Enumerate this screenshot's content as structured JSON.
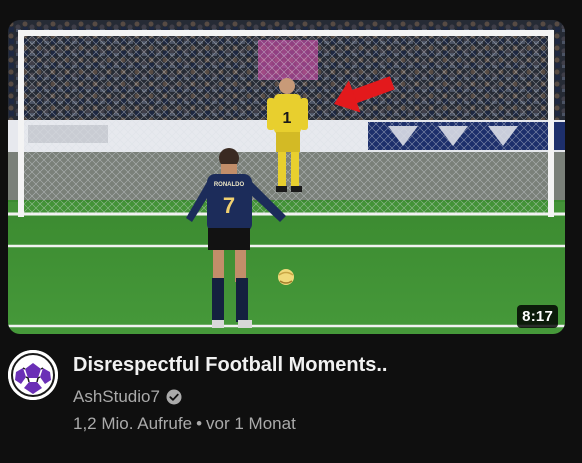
{
  "video": {
    "duration": "8:17",
    "title": "Disrespectful Football Moments..",
    "channel": "AshStudio7",
    "views": "1,2 Mio. Aufrufe",
    "separator": "•",
    "age": "vor 1 Monat",
    "jersey_front_name": "RONALDO",
    "striker_number": "7",
    "keeper_number": "1"
  },
  "icons": {
    "verified": "verified-check-icon",
    "avatar": "channel-avatar-ball-icon",
    "arrow": "red-arrow-icon"
  },
  "colors": {
    "background": "#0f0f0f",
    "title": "#f1f1f1",
    "secondary_text": "#aaaaaa",
    "pitch": "#3f8f33",
    "keeper_kit": "#e8cf2e",
    "striker_kit": "#1c2c5a",
    "arrow": "#e3191c",
    "avatar_purple": "#6a2fb6"
  }
}
